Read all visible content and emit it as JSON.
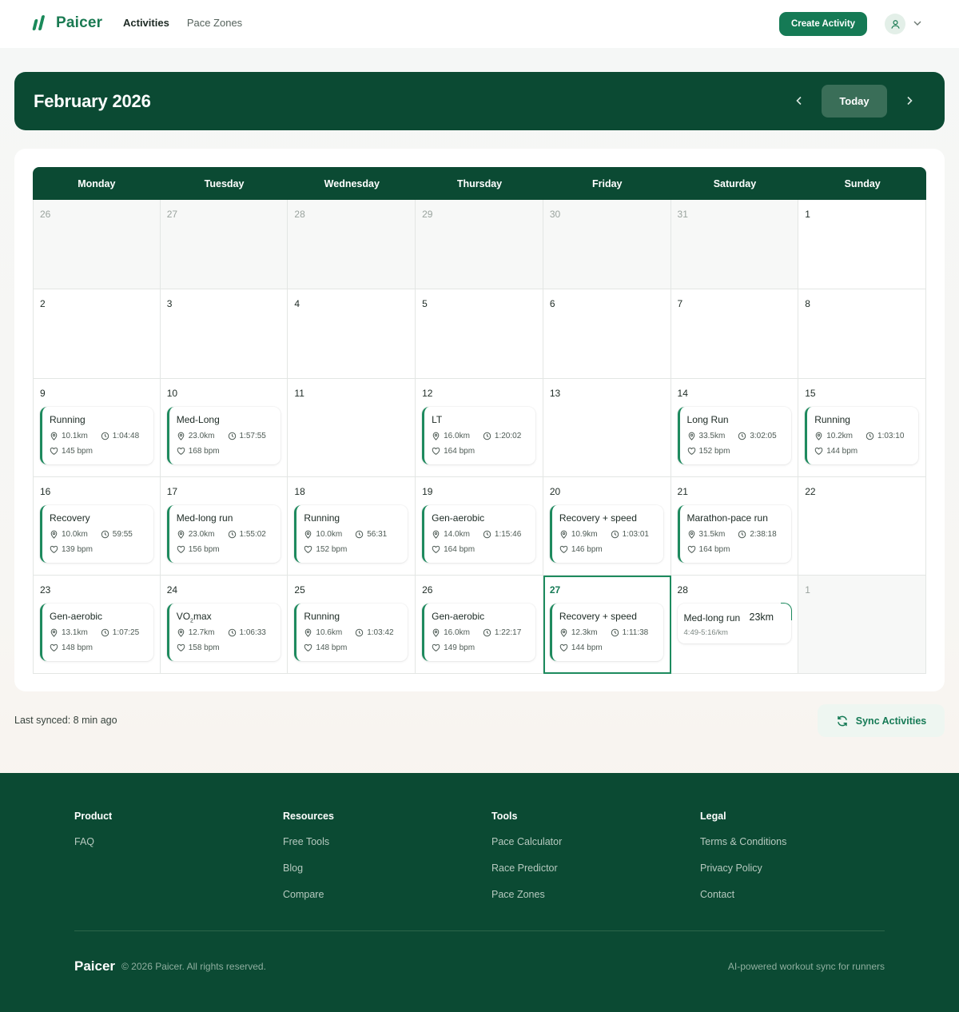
{
  "header": {
    "brand": "Paicer",
    "nav": [
      {
        "label": "Activities"
      },
      {
        "label": "Pace Zones"
      }
    ],
    "create_label": "Create Activity"
  },
  "calendar": {
    "month_title": "February 2026",
    "today_label": "Today",
    "weekdays": [
      "Monday",
      "Tuesday",
      "Wednesday",
      "Thursday",
      "Friday",
      "Saturday",
      "Sunday"
    ],
    "weeks": [
      [
        {
          "day": "26",
          "muted": true
        },
        {
          "day": "27",
          "muted": true
        },
        {
          "day": "28",
          "muted": true
        },
        {
          "day": "29",
          "muted": true
        },
        {
          "day": "30",
          "muted": true
        },
        {
          "day": "31",
          "muted": true
        },
        {
          "day": "1"
        }
      ],
      [
        {
          "day": "2"
        },
        {
          "day": "3"
        },
        {
          "day": "4"
        },
        {
          "day": "5"
        },
        {
          "day": "6"
        },
        {
          "day": "7"
        },
        {
          "day": "8"
        }
      ],
      [
        {
          "day": "9",
          "activity": {
            "title": "Running",
            "distance": "10.1km",
            "duration": "1:04:48",
            "hr": "145 bpm"
          }
        },
        {
          "day": "10",
          "activity": {
            "title": "Med-Long",
            "distance": "23.0km",
            "duration": "1:57:55",
            "hr": "168 bpm"
          }
        },
        {
          "day": "11"
        },
        {
          "day": "12",
          "activity": {
            "title": "LT",
            "distance": "16.0km",
            "duration": "1:20:02",
            "hr": "164 bpm"
          }
        },
        {
          "day": "13"
        },
        {
          "day": "14",
          "activity": {
            "title": "Long Run",
            "distance": "33.5km",
            "duration": "3:02:05",
            "hr": "152 bpm"
          }
        },
        {
          "day": "15",
          "activity": {
            "title": "Running",
            "distance": "10.2km",
            "duration": "1:03:10",
            "hr": "144 bpm"
          }
        }
      ],
      [
        {
          "day": "16",
          "activity": {
            "title": "Recovery",
            "distance": "10.0km",
            "duration": "59:55",
            "hr": "139 bpm"
          }
        },
        {
          "day": "17",
          "activity": {
            "title": "Med-long run",
            "distance": "23.0km",
            "duration": "1:55:02",
            "hr": "156 bpm"
          }
        },
        {
          "day": "18",
          "activity": {
            "title": "Running",
            "distance": "10.0km",
            "duration": "56:31",
            "hr": "152 bpm"
          }
        },
        {
          "day": "19",
          "activity": {
            "title": "Gen-aerobic",
            "distance": "14.0km",
            "duration": "1:15:46",
            "hr": "164 bpm"
          }
        },
        {
          "day": "20",
          "activity": {
            "title": "Recovery + speed",
            "distance": "10.9km",
            "duration": "1:03:01",
            "hr": "146 bpm"
          }
        },
        {
          "day": "21",
          "activity": {
            "title": "Marathon-pace run",
            "distance": "31.5km",
            "duration": "2:38:18",
            "hr": "164 bpm"
          }
        },
        {
          "day": "22"
        }
      ],
      [
        {
          "day": "23",
          "activity": {
            "title": "Gen-aerobic",
            "distance": "13.1km",
            "duration": "1:07:25",
            "hr": "148 bpm"
          }
        },
        {
          "day": "24",
          "activity": {
            "title_main": "VO",
            "title_sub": "2",
            "title_tail": "max",
            "distance": "12.7km",
            "duration": "1:06:33",
            "hr": "158 bpm"
          }
        },
        {
          "day": "25",
          "activity": {
            "title": "Running",
            "distance": "10.6km",
            "duration": "1:03:42",
            "hr": "148 bpm"
          }
        },
        {
          "day": "26",
          "activity": {
            "title": "Gen-aerobic",
            "distance": "16.0km",
            "duration": "1:22:17",
            "hr": "149 bpm"
          }
        },
        {
          "day": "27",
          "today": true,
          "activity": {
            "title": "Recovery + speed",
            "distance": "12.3km",
            "duration": "1:11:38",
            "hr": "144 bpm"
          }
        },
        {
          "day": "28",
          "planned": {
            "title": "Med-long run",
            "distance": "23km",
            "pace": "4:49-5:16/km"
          }
        },
        {
          "day": "1",
          "muted": true
        }
      ]
    ]
  },
  "sync": {
    "last_synced": "Last synced: 8 min ago",
    "button_label": "Sync Activities"
  },
  "footer": {
    "columns": [
      {
        "heading": "Product",
        "links": [
          "FAQ"
        ]
      },
      {
        "heading": "Resources",
        "links": [
          "Free Tools",
          "Blog",
          "Compare"
        ]
      },
      {
        "heading": "Tools",
        "links": [
          "Pace Calculator",
          "Race Predictor",
          "Pace Zones"
        ]
      },
      {
        "heading": "Legal",
        "links": [
          "Terms & Conditions",
          "Privacy Policy",
          "Contact"
        ]
      }
    ],
    "brand": "Paicer",
    "copyright": "© 2026 Paicer. All rights reserved.",
    "tagline": "AI-powered workout sync for runners"
  },
  "colors": {
    "brand": "#157a55",
    "dark": "#0b4a33",
    "accent_border": "#1e8a5e"
  },
  "icons": [
    "logo-mark",
    "user-icon",
    "chevron-down-icon",
    "chevron-left-icon",
    "chevron-right-icon",
    "pin-icon",
    "clock-icon",
    "heart-icon",
    "sync-icon"
  ]
}
